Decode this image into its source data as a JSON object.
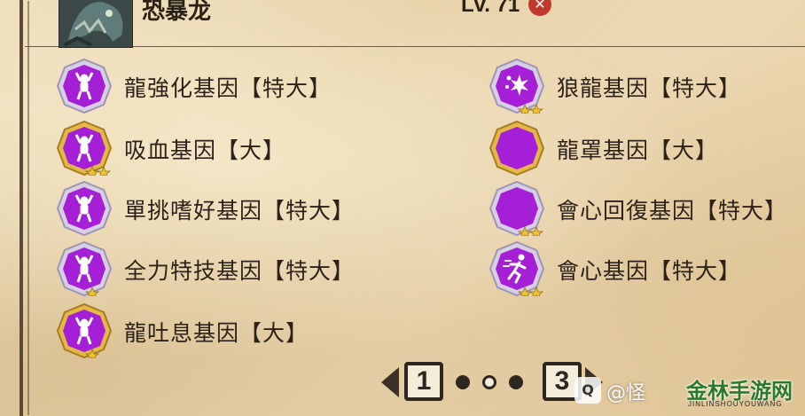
{
  "header": {
    "monster_name": "恐暴龙",
    "level": "Lv. 71",
    "attack_icon": "dragon-element-icon"
  },
  "colors": {
    "badge_purple": "#a020d0",
    "badge_silver": "#c9c2d6",
    "badge_gold": "#e0b43c",
    "star": "#f1c232",
    "text": "#2c2219"
  },
  "genes_left": [
    {
      "label": "龍強化基因【特大】",
      "icon": "dragon-power-icon",
      "frame": "silver",
      "stars": 0
    },
    {
      "label": "吸血基因【大】",
      "icon": "dragon-power-icon",
      "frame": "gold",
      "stars": 2
    },
    {
      "label": "單挑嗜好基因【特大】",
      "icon": "dragon-power-icon",
      "frame": "silver",
      "stars": 0
    },
    {
      "label": "全力特技基因【特大】",
      "icon": "dragon-power-icon",
      "frame": "silver",
      "stars": 1
    },
    {
      "label": "龍吐息基因【大】",
      "icon": "dragon-power-icon",
      "frame": "gold",
      "stars": 1
    }
  ],
  "genes_right": [
    {
      "label": "狼龍基因【特大】",
      "icon": "sparkle-burst-icon",
      "frame": "silver",
      "stars": 2
    },
    {
      "label": "龍罩基因【大】",
      "icon": "blank-gene-icon",
      "frame": "gold",
      "stars": 0
    },
    {
      "label": "會心回復基因【特大】",
      "icon": "blank-gene-icon",
      "frame": "silver",
      "stars": 2
    },
    {
      "label": "會心基因【特大】",
      "icon": "running-figure-icon",
      "frame": "silver",
      "stars": 2
    }
  ],
  "pager": {
    "first_page": "1",
    "last_page": "3",
    "current": 2
  },
  "watermark": {
    "logo": "Q",
    "handle": "@怪",
    "site": "金林手游网",
    "site_sub": "JINLINSHOUYOUWANG"
  }
}
